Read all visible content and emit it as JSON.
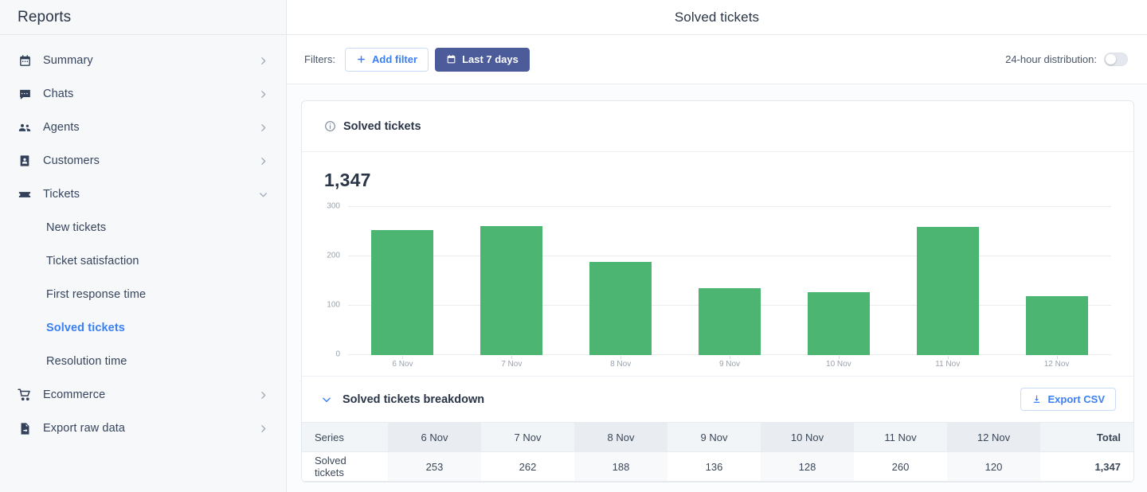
{
  "sidebar": {
    "title": "Reports",
    "items": [
      {
        "label": "Summary",
        "icon": "calendar-icon",
        "expanded": false
      },
      {
        "label": "Chats",
        "icon": "chat-icon",
        "expanded": false
      },
      {
        "label": "Agents",
        "icon": "people-icon",
        "expanded": false
      },
      {
        "label": "Customers",
        "icon": "contact-card-icon",
        "expanded": false
      },
      {
        "label": "Tickets",
        "icon": "ticket-icon",
        "expanded": true
      }
    ],
    "tickets_children": [
      {
        "label": "New tickets",
        "active": false
      },
      {
        "label": "Ticket satisfaction",
        "active": false
      },
      {
        "label": "First response time",
        "active": false
      },
      {
        "label": "Solved tickets",
        "active": true
      },
      {
        "label": "Resolution time",
        "active": false
      }
    ],
    "items_bottom": [
      {
        "label": "Ecommerce",
        "icon": "cart-icon"
      },
      {
        "label": "Export raw data",
        "icon": "export-file-icon"
      }
    ],
    "active_color": "#3b7ff5"
  },
  "header": {
    "title": "Solved tickets"
  },
  "filters": {
    "label": "Filters:",
    "add_filter_label": "Add filter",
    "date_range_label": "Last 7 days",
    "toggle_label": "24-hour distribution:",
    "toggle_state": "off",
    "primary_button_color": "#4c5b9a",
    "link_color": "#3b7ff5"
  },
  "card": {
    "title": "Solved tickets",
    "metric_value": "1,347"
  },
  "breakdown": {
    "title": "Solved tickets breakdown",
    "expanded": true,
    "export_label": "Export CSV",
    "columns": [
      "Series",
      "6 Nov",
      "7 Nov",
      "8 Nov",
      "9 Nov",
      "10 Nov",
      "11 Nov",
      "12 Nov",
      "Total"
    ],
    "rows": [
      {
        "series": "Solved tickets",
        "values": [
          "253",
          "262",
          "188",
          "136",
          "128",
          "260",
          "120"
        ],
        "total": "1,347"
      }
    ]
  },
  "chart_data": {
    "type": "bar",
    "title": "Solved tickets",
    "categories": [
      "6 Nov",
      "7 Nov",
      "8 Nov",
      "9 Nov",
      "10 Nov",
      "11 Nov",
      "12 Nov"
    ],
    "values": [
      253,
      262,
      188,
      136,
      128,
      260,
      120
    ],
    "series": [
      {
        "name": "Solved tickets",
        "values": [
          253,
          262,
          188,
          136,
          128,
          260,
          120
        ],
        "color": "#4cb572"
      }
    ],
    "xlabel": "",
    "ylabel": "",
    "ylim": [
      0,
      300
    ],
    "yticks": [
      0,
      100,
      200,
      300
    ],
    "grid": true,
    "legend": "none",
    "total": 1347
  }
}
